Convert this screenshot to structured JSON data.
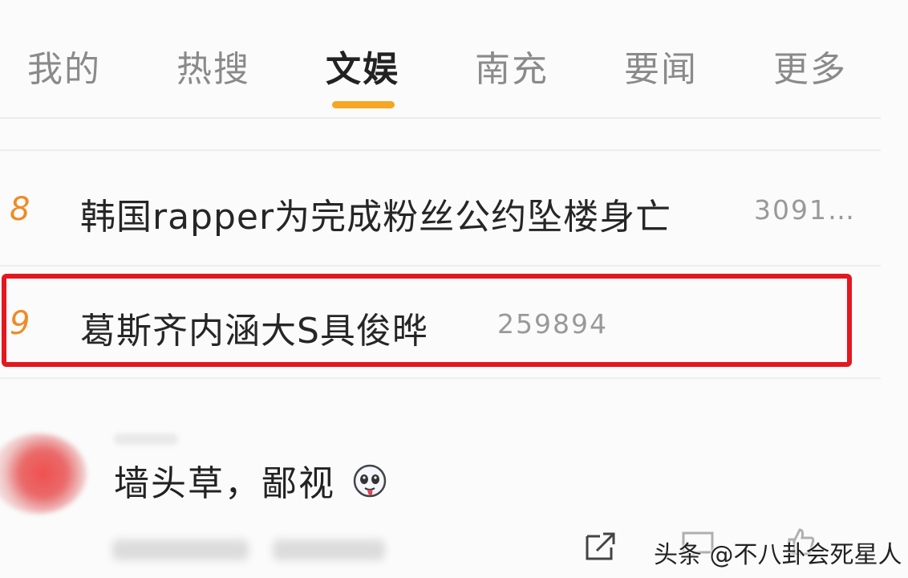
{
  "tabs": [
    "我的",
    "热搜",
    "文娱",
    "南充",
    "要闻",
    "更多"
  ],
  "active_tab": "文娱",
  "hot_list": [
    {
      "rank": "8",
      "title": "韩国rapper为完成粉丝公约坠楼身亡",
      "count": "3091…"
    },
    {
      "rank": "9",
      "title": "葛斯齐内涵大S具俊晔",
      "count": "259894"
    }
  ],
  "comment": {
    "text": "墙头草，鄙视",
    "emoji": "skull-tongue-emoji"
  },
  "watermark": "头条 @不八卦会死星人",
  "colors": {
    "accent": "#f5a623",
    "rank": "#f08a24",
    "highlight": "#e4171f"
  }
}
